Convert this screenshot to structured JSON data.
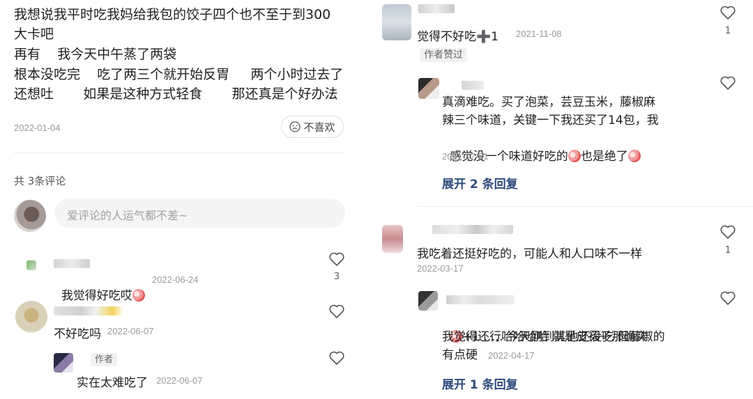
{
  "post": {
    "lines": [
      "我想说我平时吃我妈给我包的饺子四个也不至于到300",
      "大卡吧",
      "再有    我今天中午蒸了两袋",
      "根本没吃完    吃了两三个就开始反胃     两个小时过去了",
      "还想吐       如果是这种方式轻食       那还真是个好办法"
    ],
    "date": "2022-01-04",
    "dislike_label": "不喜欢"
  },
  "comments_header": "共 3条评论",
  "comment_input": {
    "placeholder": "爱评论的人运气都不差~"
  },
  "left_comments": [
    {
      "text": "我觉得好吃哎",
      "date": "2022-06-24",
      "likes": "3"
    },
    {
      "text": "不好吃吗",
      "date": "2022-06-07",
      "likes": ""
    }
  ],
  "left_reply": {
    "tag": "作者",
    "text": "实在太难吃了",
    "date": "2022-06-07"
  },
  "right_comment1": {
    "text": "觉得不好吃➕1",
    "date": "2021-11-08",
    "likes": "1",
    "author_liked_tag": "作者赞过"
  },
  "right_reply1": {
    "lines": [
      "真滴难吃。买了泡菜，芸豆玉米，藤椒麻",
      "辣三个味道，关键一下我还买了14包，我",
      "感觉没一个味道好吃的",
      "也是绝了"
    ],
    "date": "2021-12-21",
    "expand": "展开 2 条回复"
  },
  "right_comment2": {
    "text": "我吃着还挺好吃的，可能人和人口味不一样",
    "date": "2022-03-17",
    "likes": "1"
  },
  "right_reply2": {
    "lines": [
      "+1 ……今天刚到其他还没吃 但藤椒的",
      "我觉得还行哈哈哈哈 就是皮褶子那确实",
      "有点硬"
    ],
    "date": "2022-04-17",
    "expand": "展开 1 条回复"
  },
  "icons": [
    "heart-icon",
    "smiley-icon",
    "emoji-icon"
  ],
  "colors": {
    "expand_link": "#2b4a7a",
    "date": "#9a9a9a",
    "input_bg": "#f5f5f5"
  }
}
